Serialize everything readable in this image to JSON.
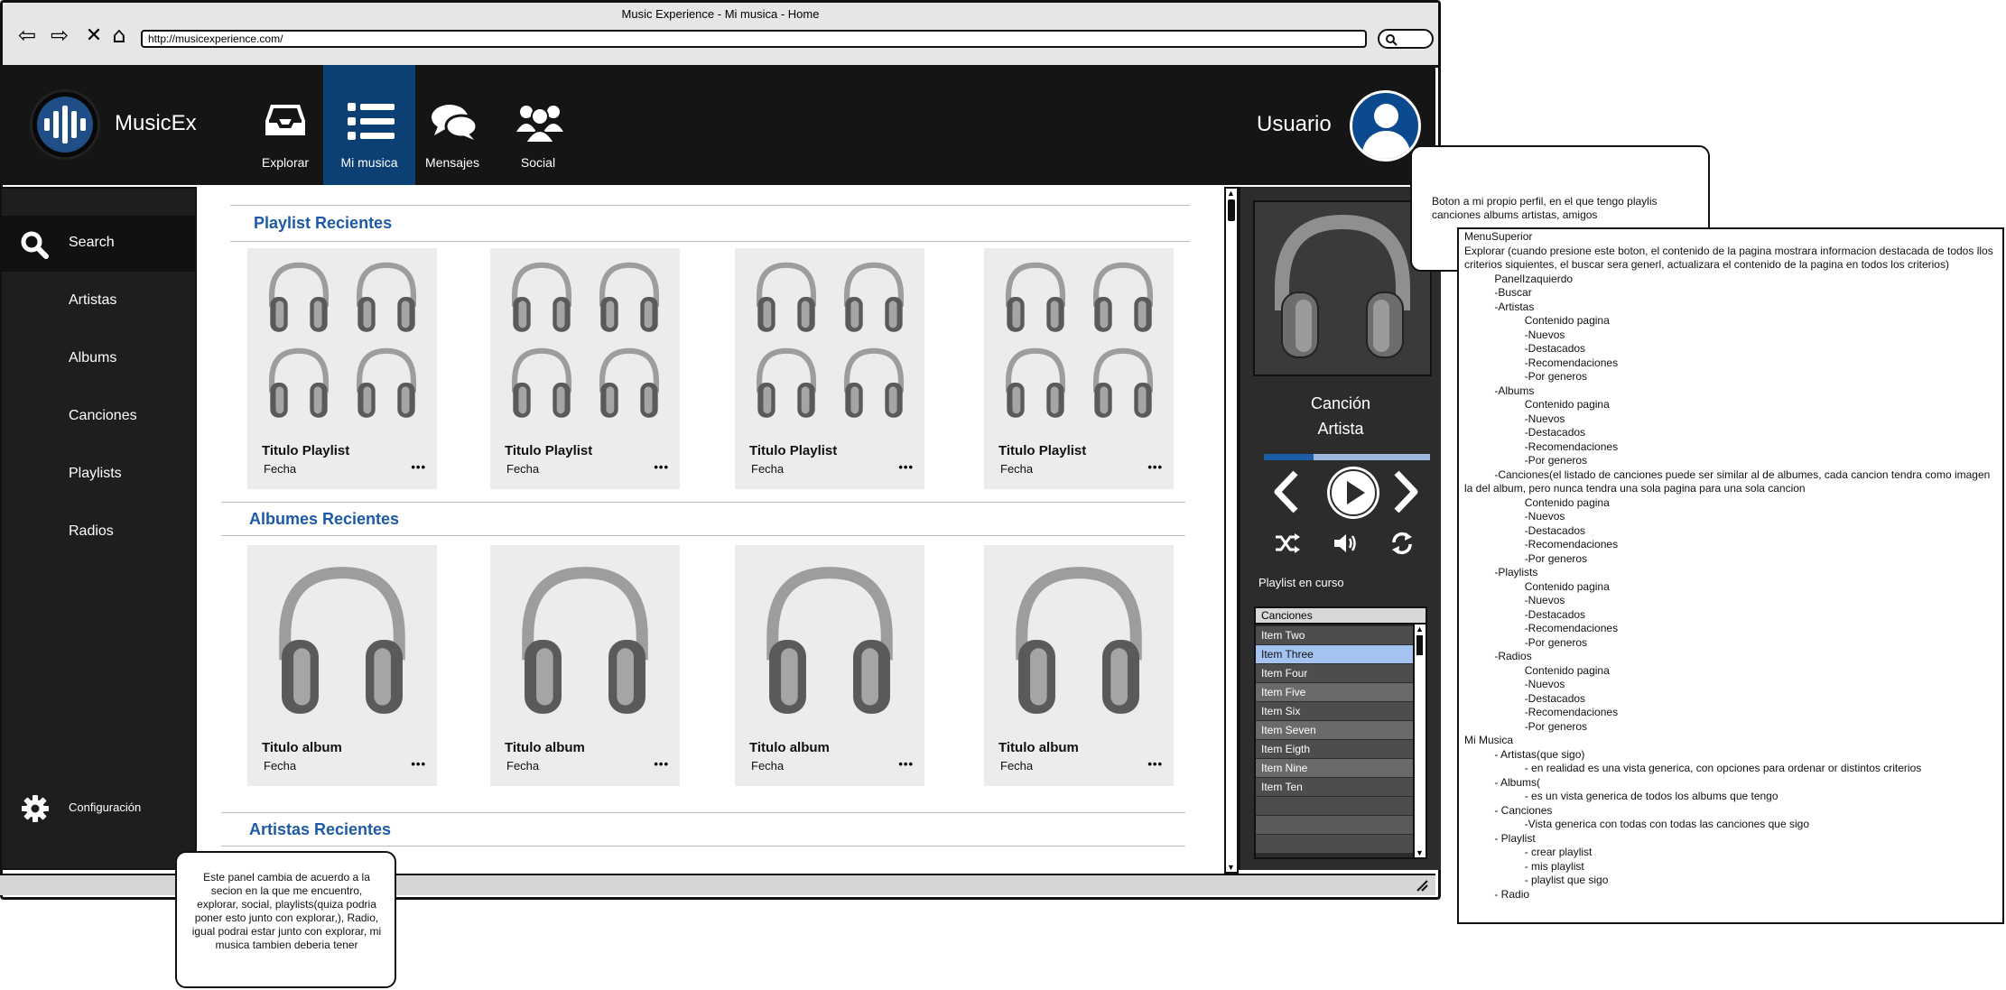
{
  "window": {
    "title": "Music Experience - Mi musica - Home",
    "url": "http://musicexperience.com/"
  },
  "header": {
    "brand": "MusicEx",
    "nav": [
      {
        "label": "Explorar",
        "icon": "inbox-icon"
      },
      {
        "label": "Mi musica",
        "icon": "list-icon",
        "active": true
      },
      {
        "label": "Mensajes",
        "icon": "chat-icon"
      },
      {
        "label": "Social",
        "icon": "people-icon"
      }
    ],
    "user_label": "Usuario"
  },
  "sidebar": {
    "items": [
      {
        "label": "Search",
        "icon": "search-icon"
      },
      {
        "label": "Artistas"
      },
      {
        "label": "Albums"
      },
      {
        "label": "Canciones"
      },
      {
        "label": "Playlists"
      },
      {
        "label": "Radios"
      }
    ],
    "config_label": "Configuración"
  },
  "main": {
    "sections": [
      {
        "title": "Playlist Recientes",
        "cards": [
          {
            "title": "Titulo Playlist",
            "date": "Fecha"
          },
          {
            "title": "Titulo Playlist",
            "date": "Fecha"
          },
          {
            "title": "Titulo Playlist",
            "date": "Fecha"
          },
          {
            "title": "Titulo Playlist",
            "date": "Fecha"
          }
        ]
      },
      {
        "title": "Albumes Recientes",
        "cards": [
          {
            "title": "Titulo album",
            "date": "Fecha"
          },
          {
            "title": "Titulo album",
            "date": "Fecha"
          },
          {
            "title": "Titulo album",
            "date": "Fecha"
          },
          {
            "title": "Titulo album",
            "date": "Fecha"
          }
        ]
      },
      {
        "title": "Artistas Recientes"
      }
    ],
    "more_glyph": "•••"
  },
  "player": {
    "song": "Canción",
    "artist": "Artista",
    "progress": 0.3,
    "playlist_label": "Playlist en curso",
    "list_header": "Canciones",
    "items": [
      "Item Two",
      "Item Three",
      "Item Four",
      "Item Five",
      "Item Six",
      "Item Seven",
      "Item Eigth",
      "Item Nine",
      "Item Ten"
    ],
    "selected_index": 1
  },
  "callouts": {
    "profile": "Boton a mi propio perfil, en el que tengo playlis canciones albums artistas, amigos",
    "panel": "Este panel cambia de acuerdo a la secion en la que me encuentro, explorar, social, playlists(quiza podria poner esto junto con explorar,), Radio, igual podrai estar junto con explorar, mi musica tambien deberia tener"
  },
  "notes": [
    "MenuSuperior",
    "Explorar (cuando presione este boton, el contenido de la pagina mostrara informacion destacada de todos llos criterios siquientes, el buscar sera generl, actualizara el contenido de la pagina en todos los criterios)",
    "          PanelIzaquierdo",
    "          -Buscar",
    "          -Artistas",
    "                    Contenido pagina",
    "                    -Nuevos",
    "                    -Destacados",
    "                    -Recomendaciones",
    "                    -Por generos",
    "          -Albums",
    "                    Contenido pagina",
    "                    -Nuevos",
    "                    -Destacados",
    "                    -Recomendaciones",
    "                    -Por generos",
    "          -Canciones(el listado de canciones puede ser similar al de albumes, cada cancion tendra como imagen la del album, pero nunca tendra una sola pagina para una sola cancion",
    "                    Contenido pagina",
    "                    -Nuevos",
    "                    -Destacados",
    "                    -Recomendaciones",
    "                    -Por generos",
    "          -Playlists",
    "                    Contenido pagina",
    "                    -Nuevos",
    "                    -Destacados",
    "                    -Recomendaciones",
    "                    -Por generos",
    "          -Radios",
    "                    Contenido pagina",
    "                    -Nuevos",
    "                    -Destacados",
    "                    -Recomendaciones",
    "                    -Por generos",
    "",
    "Mi Musica",
    "          - Artistas(que sigo)",
    "                    - en realidad es una vista generica, con opciones para ordenar or distintos criterios",
    "          - Albums(",
    "                    - es un vista generica de todos los albums que tengo",
    "          - Canciones",
    "                    -Vista generica con todas con todas las canciones que sigo",
    "          - Playlist",
    "                    - crear playlist",
    "                    - mis playlist",
    "                    - playlist que sigo",
    "          - Radio"
  ],
  "colors": {
    "accent": "#1d5aa5",
    "header_bg": "#151515",
    "active_nav": "#0c3f74",
    "selected_row": "#a4c3f0"
  }
}
